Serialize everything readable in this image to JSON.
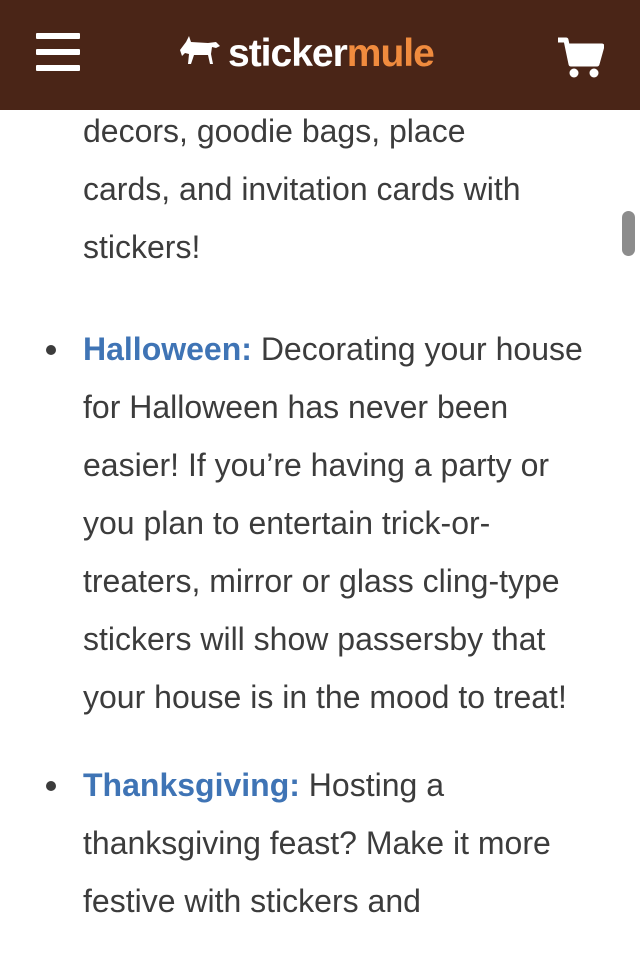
{
  "header": {
    "brand_part1": "sticker",
    "brand_part2": "mule",
    "menu_icon": "hamburger-menu-icon",
    "cart_icon": "shopping-cart-icon",
    "background_color": "#4a2517",
    "brand_accent_color": "#f08b3e"
  },
  "article": {
    "partial_paragraph_lines": [
      "decors, goodie bags, place",
      "cards, and invitation cards with",
      "stickers!"
    ],
    "items": [
      {
        "term": "Halloween:",
        "text": " Decorating your house for Halloween has never been easier! If you’re having a party or you plan to entertain trick-or-treaters, mirror or glass cling-type stickers will show passersby that your house is in the mood to treat!"
      },
      {
        "term": "Thanksgiving:",
        "text": " Hosting a thanksgiving feast? Make it more festive with stickers and"
      }
    ],
    "link_color": "#3f74b5"
  }
}
